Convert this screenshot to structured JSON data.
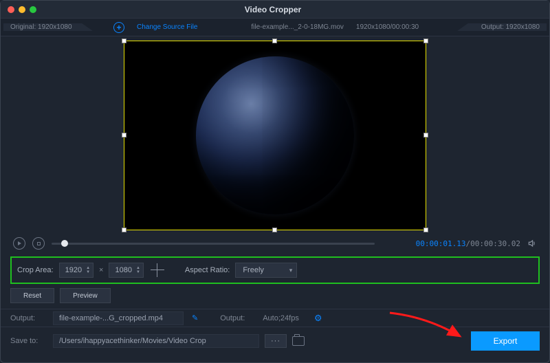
{
  "window": {
    "title": "Video Cropper"
  },
  "traffic": {
    "close": "#ff5f57",
    "min": "#febc2e",
    "max": "#28c840"
  },
  "topbar": {
    "original_label": "Original: 1920x1080",
    "change_source": "Change Source File",
    "filename": "file-example..._2-0-18MG.mov",
    "src_dims_time": "1920x1080/00:00:30",
    "output_label": "Output: 1920x1080"
  },
  "playback": {
    "current": "00:00:01.13",
    "total": "00:00:30.02",
    "progress_percent": 4
  },
  "crop": {
    "area_label": "Crop Area:",
    "width": "1920",
    "height": "1080",
    "aspect_label": "Aspect Ratio:",
    "aspect_value": "Freely"
  },
  "buttons": {
    "reset": "Reset",
    "preview": "Preview",
    "export": "Export"
  },
  "output": {
    "label": "Output:",
    "file": "file-example-...G_cropped.mp4",
    "param_label": "Output:",
    "params": "Auto;24fps"
  },
  "saveto": {
    "label": "Save to:",
    "path": "/Users/ihappyacethinker/Movies/Video Crop"
  }
}
